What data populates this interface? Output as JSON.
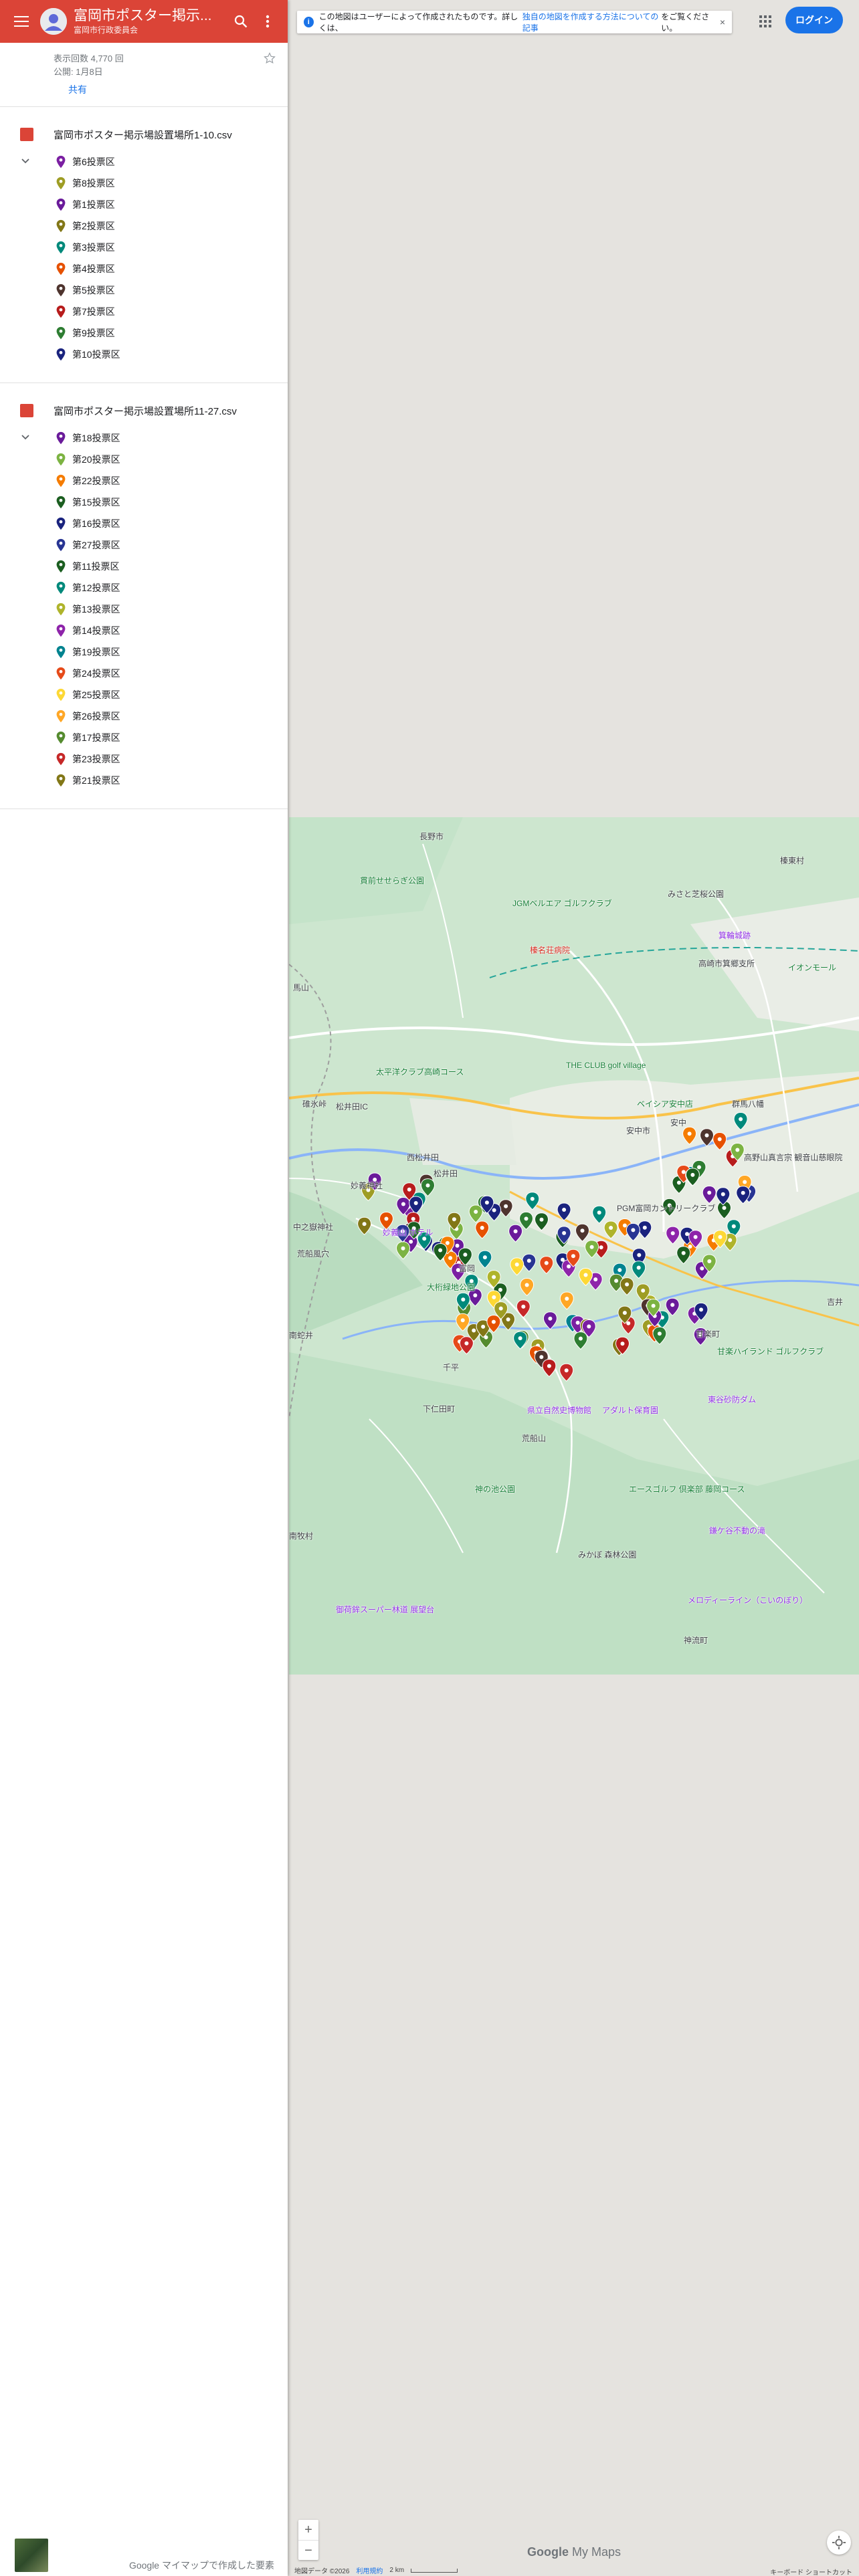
{
  "header": {
    "title": "富岡市ポスター掲示...",
    "subtitle": "富岡市行政委員会",
    "colors": {
      "brand": "#db4437"
    }
  },
  "meta": {
    "views": "表示回数 4,770 回",
    "published": "公開: 1月8日",
    "share": "共有"
  },
  "layers": [
    {
      "title": "富岡市ポスター掲示場設置場所1-10.csv",
      "items": [
        {
          "label": "第6投票区",
          "color": "#7b1fa2"
        },
        {
          "label": "第8投票区",
          "color": "#9e9d24"
        },
        {
          "label": "第1投票区",
          "color": "#6a1b9a"
        },
        {
          "label": "第2投票区",
          "color": "#827717"
        },
        {
          "label": "第3投票区",
          "color": "#00897b"
        },
        {
          "label": "第4投票区",
          "color": "#e65100"
        },
        {
          "label": "第5投票区",
          "color": "#4e342e"
        },
        {
          "label": "第7投票区",
          "color": "#b71c1c"
        },
        {
          "label": "第9投票区",
          "color": "#2e7d32"
        },
        {
          "label": "第10投票区",
          "color": "#1a237e"
        }
      ]
    },
    {
      "title": "富岡市ポスター掲示場設置場所11-27.csv",
      "items": [
        {
          "label": "第18投票区",
          "color": "#6a1b9a"
        },
        {
          "label": "第20投票区",
          "color": "#7cb342"
        },
        {
          "label": "第22投票区",
          "color": "#f57c00"
        },
        {
          "label": "第15投票区",
          "color": "#1b5e20"
        },
        {
          "label": "第16投票区",
          "color": "#1a237e"
        },
        {
          "label": "第27投票区",
          "color": "#283593"
        },
        {
          "label": "第11投票区",
          "color": "#1b5e20"
        },
        {
          "label": "第12投票区",
          "color": "#00897b"
        },
        {
          "label": "第13投票区",
          "color": "#afb42b"
        },
        {
          "label": "第14投票区",
          "color": "#8e24aa"
        },
        {
          "label": "第19投票区",
          "color": "#00838f"
        },
        {
          "label": "第24投票区",
          "color": "#e64a19"
        },
        {
          "label": "第25投票区",
          "color": "#fdd835"
        },
        {
          "label": "第26投票区",
          "color": "#ffa726"
        },
        {
          "label": "第17投票区",
          "color": "#558b2f"
        },
        {
          "label": "第23投票区",
          "color": "#c62828"
        },
        {
          "label": "第21投票区",
          "color": "#827717"
        }
      ]
    }
  ],
  "notice": {
    "before": "この地図はユーザーによって作成されたものです。詳しくは、",
    "link": "独自の地図を作成する方法についての記事",
    "after": "をご覧ください。",
    "close": "×"
  },
  "login": "ログイン",
  "map_labels": {
    "l1": "長野市",
    "l2": "榛東村",
    "l3": "貫前せせらぎ公園",
    "l4": "JGMベルエア ゴルフクラブ",
    "l5": "みさと芝桜公園",
    "l6": "榛名荘病院",
    "l7": "箕輪城跡",
    "l8": "高崎市箕郷支所",
    "l9": "イオンモール",
    "l10": "太平洋クラブ高崎コース",
    "l11": "THE CLUB golf village",
    "l12": "安中市",
    "l13": "ベイシア安中店",
    "l14": "群馬八幡",
    "l15": "西松井田",
    "l16": "松井田",
    "l17": "安中",
    "l18": "高野山真言宗 観音山慈眼院",
    "l19": "妙義神社",
    "l20": "PGM富岡カントリークラブ",
    "l21": "中之嶽神社",
    "l22": "富岡",
    "l23": "大桁緑地公園",
    "l24": "甘楽町",
    "l25": "南蛇井",
    "l26": "千平",
    "l27": "下仁田町",
    "l28": "県立自然史博物館",
    "l29": "アダルト保育園",
    "l30": "東谷砂防ダム",
    "l31": "荒船山",
    "l32": "甘楽ハイランド ゴルフクラブ",
    "l33": "南牧村",
    "l34": "神の池公園",
    "l35": "エースゴルフ 倶楽部 藤岡コース",
    "l36": "鎌ケ谷不動の滝",
    "l37": "みかぼ 森林公園",
    "l38": "御荷鉾スーパー林道 展望台",
    "l39": "メロディーライン（こいのぼり）",
    "l40": "神流町",
    "l41": "碓氷峠",
    "l42": "吉井",
    "l43": "荒船風穴",
    "l44": "馬山",
    "l45": "松井田IC",
    "l46": "妙義山 ホテル"
  },
  "footer": {
    "made_with": "Google マイマップで作成した要素",
    "brand_g": "Google",
    "brand_rest": " My Maps",
    "attribution": "地図データ ©2026",
    "terms": "利用規約",
    "scale": "2 km",
    "keyboard": "キーボード ショートカット"
  },
  "zoom": {
    "in": "+",
    "out": "−"
  },
  "icons": [
    "menu-icon",
    "avatar-icon",
    "search-icon",
    "more-vert-icon",
    "star-icon",
    "chevron-icon",
    "map-pin-icon",
    "info-icon",
    "apps-grid-icon",
    "location-icon"
  ]
}
